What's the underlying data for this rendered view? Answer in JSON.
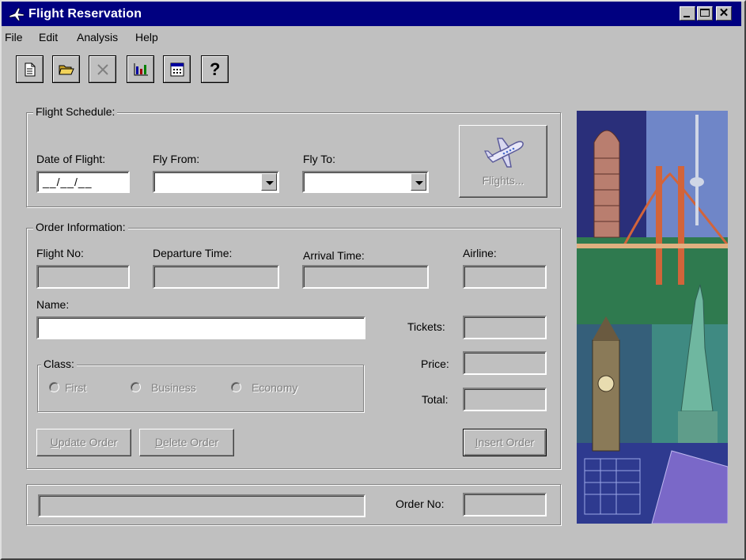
{
  "window": {
    "title": "Flight Reservation",
    "minimize_icon": "minimize-icon",
    "maximize_icon": "maximize-icon",
    "close_icon": "close-icon"
  },
  "menu": [
    "File",
    "Edit",
    "Analysis",
    "Help"
  ],
  "toolbar": {
    "buttons": [
      {
        "icon": "new-document-icon"
      },
      {
        "icon": "open-folder-icon"
      },
      {
        "icon": "delete-x-icon"
      },
      {
        "icon": "bar-chart-icon"
      },
      {
        "icon": "calendar-icon"
      },
      {
        "icon": "help-icon",
        "label": "?"
      }
    ]
  },
  "flight_schedule": {
    "legend": "Flight Schedule:",
    "date_label": "Date of Flight:",
    "date_value": "__/__/__",
    "from_label": "Fly From:",
    "from_value": "",
    "to_label": "Fly To:",
    "to_value": "",
    "flights_button": "Flights..."
  },
  "order_info": {
    "legend": "Order Information:",
    "flight_no_label": "Flight No:",
    "departure_label": "Departure Time:",
    "arrival_label": "Arrival Time:",
    "airline_label": "Airline:",
    "name_label": "Name:",
    "name_value": "",
    "tickets_label": "Tickets:",
    "price_label": "Price:",
    "total_label": "Total:",
    "class_legend": "Class:",
    "class_options": [
      "First",
      "Business",
      "Economy"
    ],
    "update_button": "Update Order",
    "delete_button": "Delete Order",
    "insert_button": "Insert Order"
  },
  "status": {
    "order_no_label": "Order No:",
    "order_no_value": ""
  },
  "colors": {
    "titlebar": "#000080",
    "face": "#c0c0c0"
  }
}
